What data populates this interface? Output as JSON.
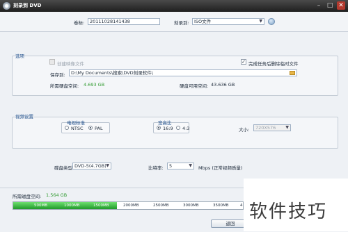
{
  "window": {
    "title": "刻录到 DVD",
    "min_glyph": "–",
    "max_glyph": "□",
    "close_glyph": "✕"
  },
  "top": {
    "label_name": "卷标:",
    "label_value": "20111028141438",
    "burn_to_label": "刻录到:",
    "burn_to_value": "ISO文件"
  },
  "options": {
    "title": "选项",
    "create_image_label": "创建映像文件",
    "create_image_checked": false,
    "delete_temp_label": "完成任务后删除临时文件",
    "delete_temp_checked": true,
    "save_to_label": "保存到:",
    "save_to_value": "D:\\My Documents\\搜索\\DVD刻录软件\\",
    "required_space_label": "所需硬盘空间:",
    "required_space_value": "4.693 GB",
    "available_space_label": "硬盘可用空间:",
    "available_space_value": "43.636 GB",
    "check_glyph": "✓"
  },
  "video": {
    "title": "视频设置",
    "tv_standard_label": "电视标准",
    "ntsc_label": "NTSC",
    "pal_label": "PAL",
    "tv_standard_selected": "PAL",
    "aspect_label": "宽高比",
    "aspect_169": "16:9",
    "aspect_43": "4:3",
    "aspect_selected": "16:9",
    "size_label": "大小:",
    "size_value": "720X576"
  },
  "disc": {
    "disc_type_label": "碟盘类型:",
    "disc_type_value": "DVD-5(4.7GB)",
    "bitrate_label": "比特率:",
    "bitrate_value": "5",
    "bitrate_unit": "Mbps (正常视频质量)"
  },
  "footer": {
    "required_label": "所需磁盘空间:",
    "required_value": "1.564 GB",
    "used_fraction": 0.45,
    "ticks": [
      "500MB",
      "1000MB",
      "1500MB",
      "2000MB",
      "2500MB",
      "3000MB",
      "3500MB",
      "4"
    ],
    "back_button": "返回"
  },
  "watermark": "软件技巧",
  "colors": {
    "accent": "#1f4f8c",
    "progress_green": "#2f9a2f",
    "titlebar": "#2b2b2b"
  }
}
